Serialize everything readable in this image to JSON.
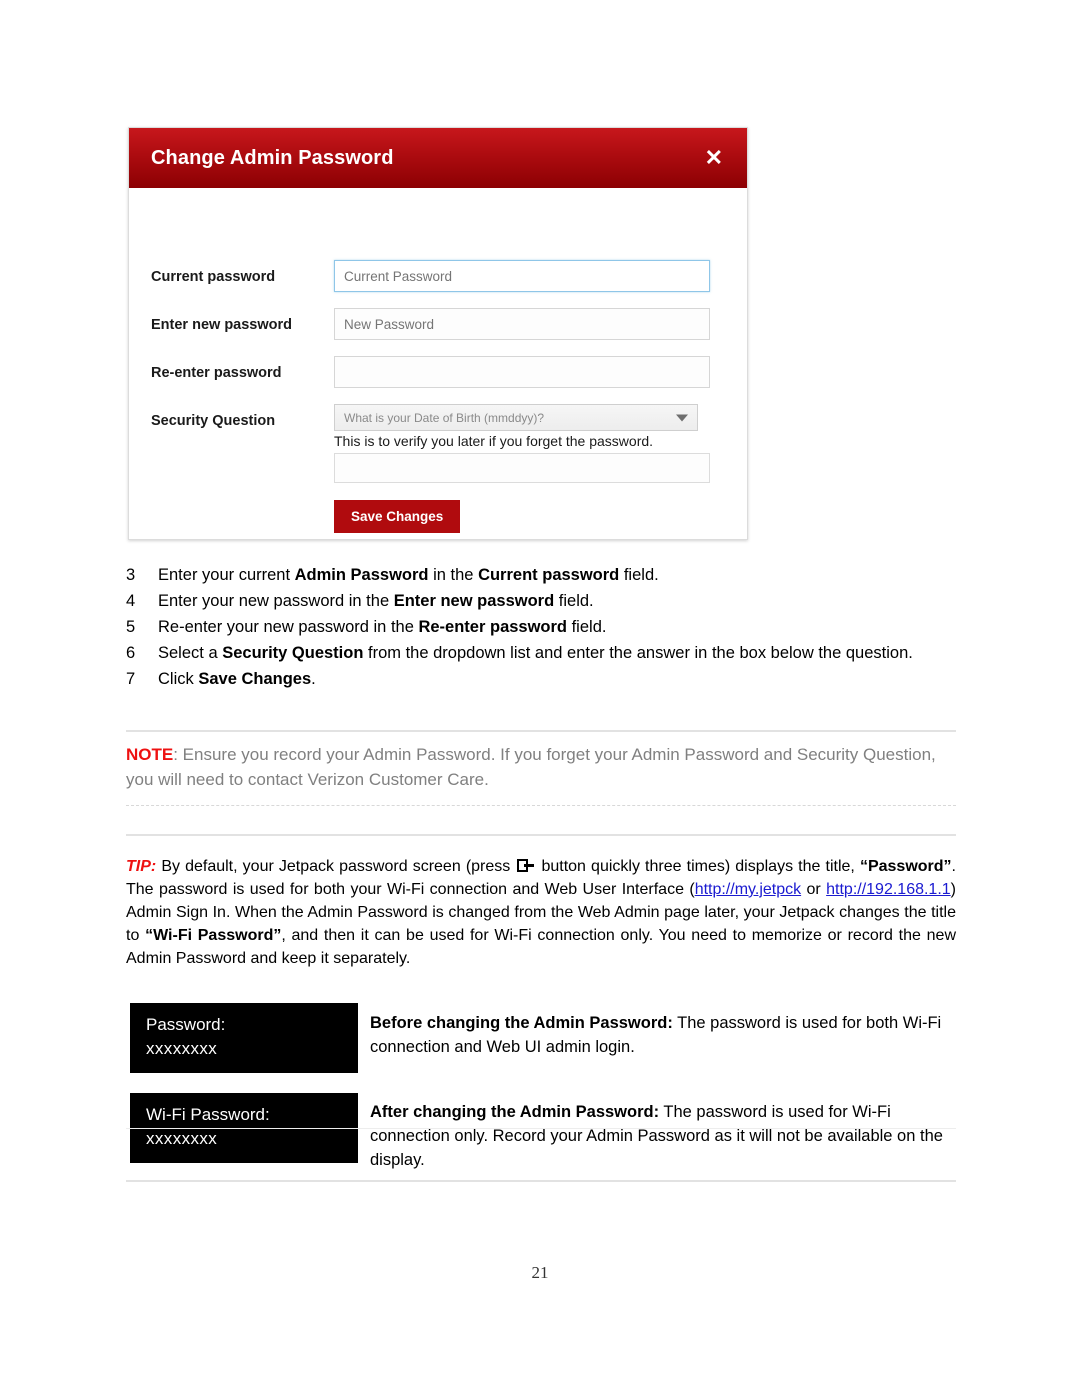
{
  "dialog": {
    "title": "Change Admin Password",
    "close_icon": "close-x-icon",
    "fields": {
      "current_password": {
        "label": "Current password",
        "placeholder": "Current Password",
        "value": ""
      },
      "new_password": {
        "label": "Enter new password",
        "placeholder": "New Password",
        "value": ""
      },
      "reenter_password": {
        "label": "Re-enter password",
        "placeholder": "",
        "value": ""
      },
      "security_question": {
        "label": "Security Question",
        "selected": "What is your Date of Birth (mmddyy)?",
        "helper": "This is to verify you later if you forget the password.",
        "answer_placeholder": "",
        "answer_value": "",
        "caret_icon": "chevron-down-icon"
      }
    },
    "save_button": "Save Changes",
    "colors": {
      "header_top": "#c7171c",
      "header_bottom": "#8c0003",
      "save_button": "#b00b0e",
      "focus_border": "#8fc6e8"
    }
  },
  "steps": [
    {
      "number": "3",
      "parts": [
        {
          "t": "Enter your current ",
          "b": false
        },
        {
          "t": "Admin Password",
          "b": true
        },
        {
          "t": " in the ",
          "b": false
        },
        {
          "t": "Current password",
          "b": true
        },
        {
          "t": " field.",
          "b": false
        }
      ]
    },
    {
      "number": "4",
      "parts": [
        {
          "t": "Enter your new password in the ",
          "b": false
        },
        {
          "t": "Enter new password",
          "b": true
        },
        {
          "t": " field.",
          "b": false
        }
      ]
    },
    {
      "number": "5",
      "parts": [
        {
          "t": "Re-enter your new password in the ",
          "b": false
        },
        {
          "t": "Re-enter password",
          "b": true
        },
        {
          "t": " field.",
          "b": false
        }
      ]
    },
    {
      "number": "6",
      "parts": [
        {
          "t": "Select a ",
          "b": false
        },
        {
          "t": "Security Question",
          "b": true
        },
        {
          "t": " from the dropdown list and enter the answer in the box below the question.",
          "b": false
        }
      ]
    },
    {
      "number": "7",
      "parts": [
        {
          "t": "Click ",
          "b": false
        },
        {
          "t": "Save Changes",
          "b": true
        },
        {
          "t": ".",
          "b": false
        }
      ]
    }
  ],
  "note": {
    "keyword": "NOTE",
    "text": ": Ensure you record your Admin Password.  If you forget your Admin Password and Security Question, you will need to contact Verizon Customer Care."
  },
  "tip": {
    "keyword": "TIP:",
    "seg1": " By default, your Jetpack password screen (press ",
    "button_icon": "jetpack-menu-button-icon",
    "seg2": " button quickly three times) displays the title, ",
    "quoted1": "“Password”",
    "seg3": ". The password is used for both your Wi-Fi connection and Web User Interface (",
    "link1": "http://my.jetpck",
    "seg4": " or ",
    "link2": "http://192.168.1.1",
    "seg5": ") Admin Sign In.  When the Admin Password is changed from the Web Admin page later, your Jetpack changes the title to ",
    "quoted2": "“Wi-Fi Password”",
    "seg6": ", and then it can be used for Wi-Fi connection only. You need to memorize or record the new Admin Password and keep it separately."
  },
  "display_boxes": [
    {
      "label": "Password:",
      "value": "xxxxxxxx",
      "desc_bold": "Before changing the Admin Password:",
      "desc_rest": " The password is used for both Wi-Fi connection and Web UI admin login."
    },
    {
      "label": "Wi-Fi Password:",
      "value": "xxxxxxxx",
      "desc_bold": "After changing the Admin Password:",
      "desc_rest": " The password is used for Wi-Fi connection only. Record your Admin Password as it will not be available on the display."
    }
  ],
  "page_number": "21"
}
